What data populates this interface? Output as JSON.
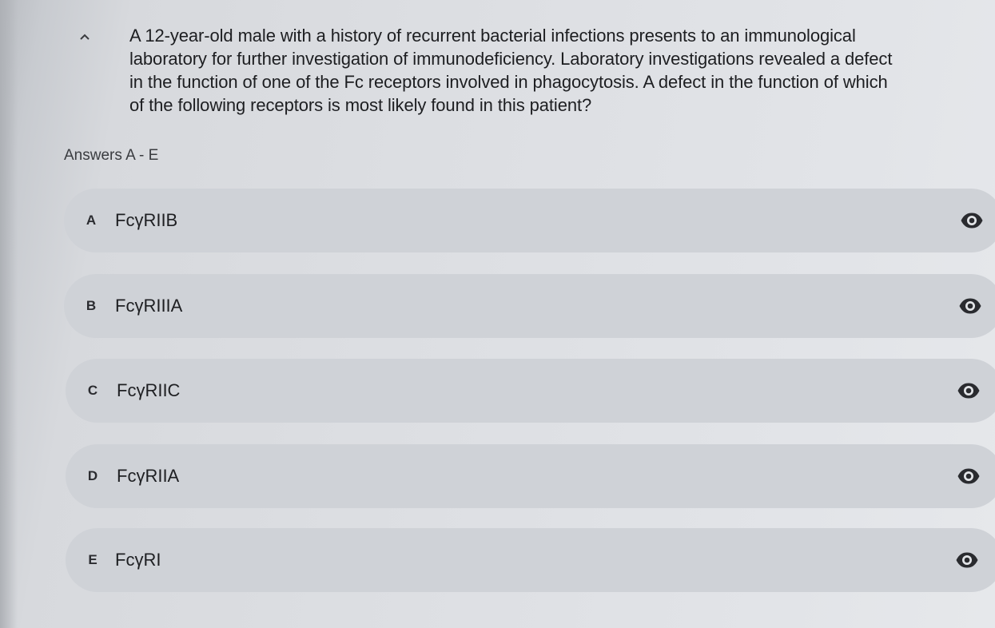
{
  "question": {
    "lines": [
      "A 12-year-old male with a history of recurrent bacterial infections presents to an immunological",
      "laboratory for further investigation of immunodeficiency. Laboratory investigations revealed a defect",
      "in the function of one of the Fc receptors involved in phagocytosis. A defect in the function of which",
      "of the following receptors is most likely found in this patient?"
    ]
  },
  "answers": {
    "heading": "Answers A - E",
    "options": [
      {
        "letter": "A",
        "text": "FcγRIIB"
      },
      {
        "letter": "B",
        "text": "FcγRIIIA"
      },
      {
        "letter": "C",
        "text": "FcγRIIC"
      },
      {
        "letter": "D",
        "text": "FcγRIIA"
      },
      {
        "letter": "E",
        "text": "FcγRI"
      }
    ]
  },
  "icons": {
    "collapse": "chevron-up-icon",
    "reveal": "eye-icon"
  },
  "colors": {
    "option_background": "#cfd2d7",
    "icon": "#2a2b2f",
    "text": "#1d1e21"
  }
}
